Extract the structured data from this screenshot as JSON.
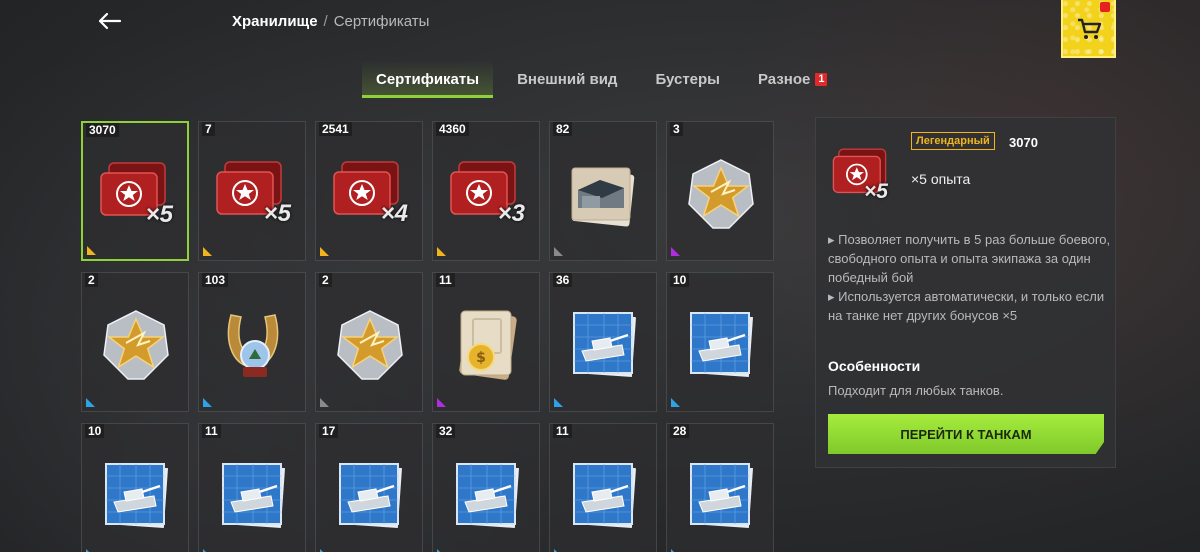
{
  "header": {
    "breadcrumb_main": "Хранилище",
    "breadcrumb_sep": "/",
    "breadcrumb_sub": "Сертификаты"
  },
  "tabs": [
    {
      "label": "Сертификаты",
      "active": true
    },
    {
      "label": "Внешний вид"
    },
    {
      "label": "Бустеры"
    },
    {
      "label": "Разное",
      "badge": "1"
    }
  ],
  "items": [
    {
      "count": "3070",
      "kind": "cert",
      "mult": "×5",
      "rarity": "legendary",
      "selected": true
    },
    {
      "count": "7",
      "kind": "cert",
      "mult": "×5",
      "rarity": "legendary"
    },
    {
      "count": "2541",
      "kind": "cert",
      "mult": "×4",
      "rarity": "legendary"
    },
    {
      "count": "4360",
      "kind": "cert",
      "mult": "×3",
      "rarity": "legendary"
    },
    {
      "count": "82",
      "kind": "hangar",
      "rarity": "common"
    },
    {
      "count": "3",
      "kind": "star",
      "rarity": "epic"
    },
    {
      "count": "2",
      "kind": "star",
      "rarity": "rare"
    },
    {
      "count": "103",
      "kind": "horseshoe",
      "rarity": "rare"
    },
    {
      "count": "2",
      "kind": "star",
      "rarity": "common"
    },
    {
      "count": "11",
      "kind": "coin",
      "rarity": "epic"
    },
    {
      "count": "36",
      "kind": "blueprint",
      "rarity": "rare"
    },
    {
      "count": "10",
      "kind": "blueprint",
      "rarity": "rare"
    },
    {
      "count": "10",
      "kind": "blueprint",
      "rarity": "rare"
    },
    {
      "count": "11",
      "kind": "blueprint",
      "rarity": "rare"
    },
    {
      "count": "17",
      "kind": "blueprint",
      "rarity": "rare"
    },
    {
      "count": "32",
      "kind": "blueprint",
      "rarity": "rare"
    },
    {
      "count": "11",
      "kind": "blueprint",
      "rarity": "rare"
    },
    {
      "count": "28",
      "kind": "blueprint",
      "rarity": "rare"
    }
  ],
  "details": {
    "rarity": "Легендарный",
    "count": "3070",
    "mult": "×5",
    "subtitle": "×5 опыта",
    "desc_line1": "▸ Позволяет получить в 5 раз больше боевого, свободного опыта и опыта экипажа за один победный бой",
    "desc_line2": "▸ Используется автоматически, и только если на танке нет других бонусов ×5",
    "features_title": "Особенности",
    "features_text": "Подходит для любых танков.",
    "button": "ПЕРЕЙТИ К ТАНКАМ"
  },
  "colors": {
    "accent": "#8fd13a",
    "legendary": "#f0b51e",
    "epic": "#b02de0",
    "rare": "#2fa2e6",
    "common": "#8a8a8a",
    "shop": "#f3d21c"
  }
}
